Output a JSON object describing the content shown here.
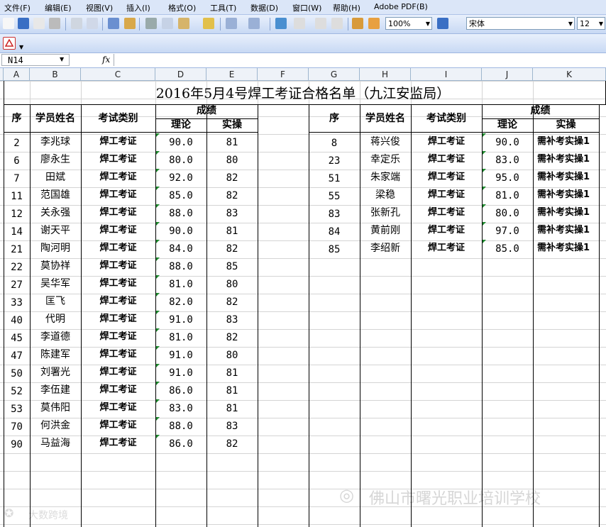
{
  "menu": [
    "文件(F)",
    "编辑(E)",
    "视图(V)",
    "插入(I)",
    "格式(O)",
    "工具(T)",
    "数据(D)",
    "窗口(W)",
    "帮助(H)",
    "Adobe PDF(B)"
  ],
  "toolbar": {
    "zoom": "100%",
    "font": "宋体",
    "size": "12"
  },
  "namebox": "N14",
  "fx": "fx",
  "columns": [
    "A",
    "B",
    "C",
    "D",
    "E",
    "F",
    "G",
    "H",
    "I",
    "J",
    "K"
  ],
  "title": "2016年5月4号焊工考证合格名单（九江安监局）",
  "headers": {
    "seq": "序",
    "name": "学员姓名",
    "type": "考试类别",
    "score": "成绩",
    "theory": "理论",
    "practice": "实操"
  },
  "left_rows": [
    {
      "seq": "2",
      "name": "李兆球",
      "type": "焊工考证",
      "theory": "90.0",
      "practice": "81"
    },
    {
      "seq": "6",
      "name": "廖永生",
      "type": "焊工考证",
      "theory": "80.0",
      "practice": "80"
    },
    {
      "seq": "7",
      "name": "田斌",
      "type": "焊工考证",
      "theory": "92.0",
      "practice": "82"
    },
    {
      "seq": "11",
      "name": "范国雄",
      "type": "焊工考证",
      "theory": "85.0",
      "practice": "82"
    },
    {
      "seq": "12",
      "name": "关永强",
      "type": "焊工考证",
      "theory": "88.0",
      "practice": "83"
    },
    {
      "seq": "14",
      "name": "谢天平",
      "type": "焊工考证",
      "theory": "90.0",
      "practice": "81"
    },
    {
      "seq": "21",
      "name": "陶河明",
      "type": "焊工考证",
      "theory": "84.0",
      "practice": "82"
    },
    {
      "seq": "22",
      "name": "莫协祥",
      "type": "焊工考证",
      "theory": "88.0",
      "practice": "85"
    },
    {
      "seq": "27",
      "name": "吴华军",
      "type": "焊工考证",
      "theory": "81.0",
      "practice": "80"
    },
    {
      "seq": "33",
      "name": "匡飞",
      "type": "焊工考证",
      "theory": "82.0",
      "practice": "82"
    },
    {
      "seq": "40",
      "name": "代明",
      "type": "焊工考证",
      "theory": "91.0",
      "practice": "83"
    },
    {
      "seq": "45",
      "name": "李道德",
      "type": "焊工考证",
      "theory": "81.0",
      "practice": "82"
    },
    {
      "seq": "47",
      "name": "陈建军",
      "type": "焊工考证",
      "theory": "91.0",
      "practice": "80"
    },
    {
      "seq": "50",
      "name": "刘署光",
      "type": "焊工考证",
      "theory": "91.0",
      "practice": "81"
    },
    {
      "seq": "52",
      "name": "李伍建",
      "type": "焊工考证",
      "theory": "86.0",
      "practice": "81"
    },
    {
      "seq": "53",
      "name": "莫伟阳",
      "type": "焊工考证",
      "theory": "83.0",
      "practice": "81"
    },
    {
      "seq": "70",
      "name": "何洪金",
      "type": "焊工考证",
      "theory": "88.0",
      "practice": "83"
    },
    {
      "seq": "90",
      "name": "马益海",
      "type": "焊工考证",
      "theory": "86.0",
      "practice": "82"
    }
  ],
  "right_rows": [
    {
      "seq": "8",
      "name": "蒋兴俊",
      "type": "焊工考证",
      "theory": "90.0",
      "practice": "需补考实操1"
    },
    {
      "seq": "23",
      "name": "幸定乐",
      "type": "焊工考证",
      "theory": "83.0",
      "practice": "需补考实操1"
    },
    {
      "seq": "51",
      "name": "朱家端",
      "type": "焊工考证",
      "theory": "95.0",
      "practice": "需补考实操1"
    },
    {
      "seq": "55",
      "name": "梁稳",
      "type": "焊工考证",
      "theory": "81.0",
      "practice": "需补考实操1"
    },
    {
      "seq": "83",
      "name": "张新孔",
      "type": "焊工考证",
      "theory": "80.0",
      "practice": "需补考实操1"
    },
    {
      "seq": "84",
      "name": "黄前刚",
      "type": "焊工考证",
      "theory": "97.0",
      "practice": "需补考实操1"
    },
    {
      "seq": "85",
      "name": "李绍新",
      "type": "焊工考证",
      "theory": "85.0",
      "practice": "需补考实操1"
    }
  ],
  "watermark": "佛山市曙光职业培训学校",
  "watermark2": "大数跨境"
}
